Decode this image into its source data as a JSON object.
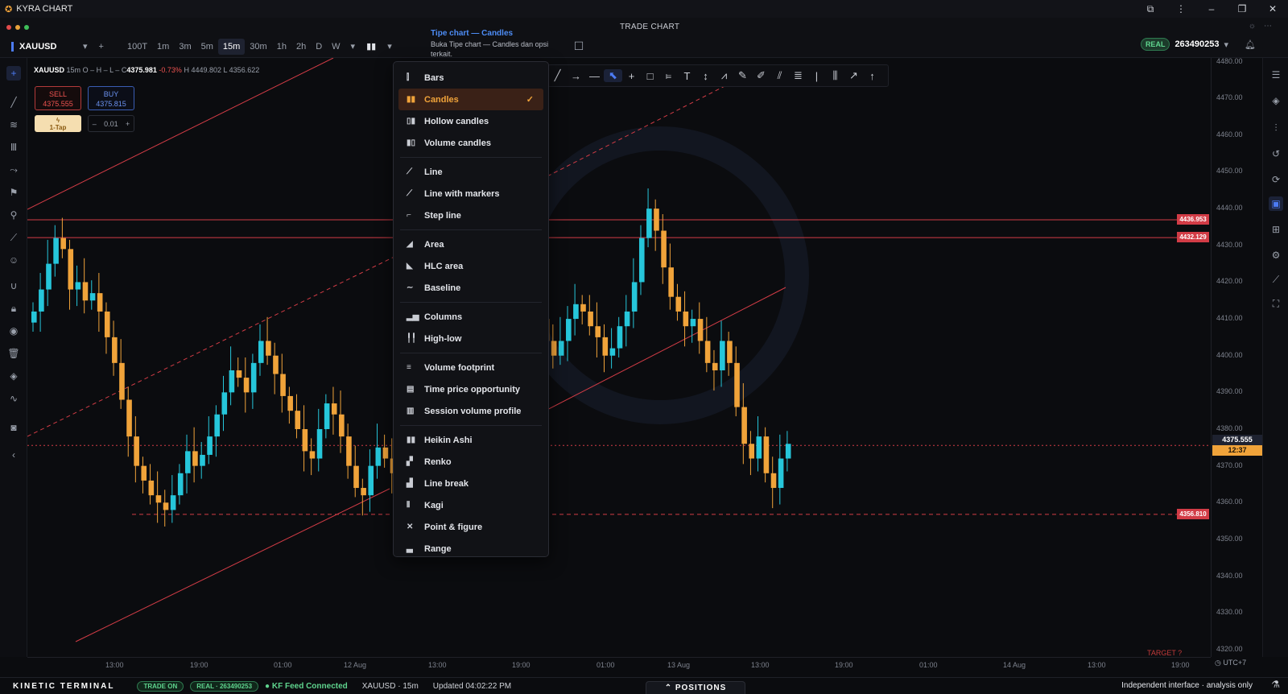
{
  "app": {
    "title": "KYRA CHART",
    "logo_icon": "rocket-icon",
    "center_title": "TRADE CHART"
  },
  "colors": {
    "accent": "#f0a33a",
    "bull": "#26c6da",
    "bear": "#f0a33a",
    "line": "#d23c46",
    "blue": "#4c7bf3",
    "green": "#5fd48e"
  },
  "toolbar": {
    "symbol": "XAUUSD",
    "add": "+",
    "timeframes": [
      "100T",
      "1m",
      "3m",
      "5m",
      "15m",
      "30m",
      "1h",
      "2h",
      "D",
      "W"
    ],
    "active_timeframe": "15m"
  },
  "tooltip": {
    "title": "Tipe chart — Candles",
    "desc": "Buka Tipe chart — Candles dan opsi terkait."
  },
  "account": {
    "mode": "REAL",
    "number": "263490253"
  },
  "chart_header": {
    "symbol": "XAUUSD",
    "timeframe": "15m",
    "o": "O –",
    "h": "H –",
    "l": "L –",
    "c": "C",
    "close": "4375.981",
    "change": "-0.73%",
    "high": "H 4449.802",
    "low": "L 4356.622"
  },
  "trade": {
    "sell_label": "SELL",
    "sell_price": "4375.555",
    "buy_label": "BUY",
    "buy_price": "4375.815",
    "one_tap": "1-Tap",
    "lot_minus": "–",
    "lot": "0.01",
    "lot_plus": "+"
  },
  "menu": {
    "items": [
      {
        "label": "Bars",
        "icon": "bars-icon"
      },
      {
        "label": "Candles",
        "icon": "candles-icon",
        "selected": true
      },
      {
        "label": "Hollow candles",
        "icon": "hollow-candles-icon"
      },
      {
        "label": "Volume candles",
        "icon": "volume-candles-icon"
      },
      {
        "label": "Line",
        "icon": "line-icon"
      },
      {
        "label": "Line with markers",
        "icon": "line-markers-icon"
      },
      {
        "label": "Step line",
        "icon": "step-line-icon"
      },
      {
        "label": "Area",
        "icon": "area-icon"
      },
      {
        "label": "HLC area",
        "icon": "hlc-area-icon"
      },
      {
        "label": "Baseline",
        "icon": "baseline-icon"
      },
      {
        "label": "Columns",
        "icon": "columns-icon"
      },
      {
        "label": "High-low",
        "icon": "high-low-icon"
      },
      {
        "label": "Volume footprint",
        "icon": "volume-footprint-icon"
      },
      {
        "label": "Time price opportunity",
        "icon": "tpo-icon"
      },
      {
        "label": "Session volume profile",
        "icon": "session-volume-icon"
      },
      {
        "label": "Heikin Ashi",
        "icon": "heikin-ashi-icon"
      },
      {
        "label": "Renko",
        "icon": "renko-icon"
      },
      {
        "label": "Line break",
        "icon": "line-break-icon"
      },
      {
        "label": "Kagi",
        "icon": "kagi-icon"
      },
      {
        "label": "Point & figure",
        "icon": "point-figure-icon"
      },
      {
        "label": "Range",
        "icon": "range-icon"
      }
    ],
    "checkmark": "✓"
  },
  "price_axis": {
    "labels": [
      "4480.00",
      "4470.00",
      "4460.00",
      "4450.00",
      "4440.00",
      "4430.00",
      "4420.00",
      "4410.00",
      "4400.00",
      "4390.00",
      "4380.00",
      "4370.00",
      "4360.00",
      "4350.00",
      "4340.00",
      "4330.00",
      "4320.00"
    ],
    "current_price": "4375.555",
    "countdown": "12:37",
    "levels": [
      "4436.953",
      "4432.129",
      "4356.810"
    ]
  },
  "time_axis": {
    "labels": [
      "13:00",
      "19:00",
      "01:00",
      "12 Aug",
      "13:00",
      "19:00",
      "01:00",
      "13 Aug",
      "13:00",
      "19:00",
      "01:00",
      "14 Aug",
      "13:00",
      "19:00"
    ],
    "timezone": "UTC+7"
  },
  "annotations": {
    "target": "TARGET ?"
  },
  "status": {
    "brand": "KINETIC TERMINAL",
    "trade_on": "TRADE ON",
    "real_account": "REAL · 263490253",
    "feed": "KF Feed Connected",
    "symbol_tf": "XAUUSD · 15m",
    "updated": "Updated 04:02:22 PM",
    "positions": "⌃ POSITIONS",
    "right": "Independent interface · analysis only"
  },
  "chart_data": {
    "type": "candlestick",
    "y_range": [
      4318,
      4481
    ],
    "price_axis_ticks": [
      4480,
      4470,
      4460,
      4450,
      4440,
      4430,
      4420,
      4410,
      4400,
      4390,
      4380,
      4370,
      4360,
      4350,
      4340,
      4330,
      4320
    ],
    "horizontal_levels": [
      4436.953,
      4432.129,
      4375.555,
      4356.81
    ],
    "closes": [
      4412,
      4418,
      4425,
      4432,
      4429,
      4418,
      4420,
      4415,
      4417,
      4412,
      4405,
      4398,
      4388,
      4378,
      4370,
      4366,
      4362,
      4360,
      4358,
      4362,
      4368,
      4374,
      4370,
      4373,
      4378,
      4384,
      4390,
      4396,
      4394,
      4390,
      4398,
      4404,
      4400,
      4395,
      4389,
      4385,
      4380,
      4374,
      4372,
      4380,
      4387,
      4384,
      4378,
      4370,
      4364,
      4362,
      4370,
      4375,
      4372,
      4368,
      4373,
      4380,
      4376,
      4370,
      4372,
      4378,
      4386,
      4392,
      4396,
      4402,
      4410,
      4420,
      4425,
      4420,
      4426,
      4430,
      4420,
      4414,
      4416,
      4410,
      4404,
      4400,
      4404,
      4410,
      4414,
      4412,
      4408,
      4405,
      4400,
      4402,
      4408,
      4412,
      4420,
      4432,
      4440,
      4434,
      4424,
      4416,
      4412,
      4408,
      4410,
      4404,
      4398,
      4396,
      4404,
      4398,
      4386,
      4376,
      4372,
      4378,
      4368,
      4364,
      4372,
      4376
    ]
  }
}
